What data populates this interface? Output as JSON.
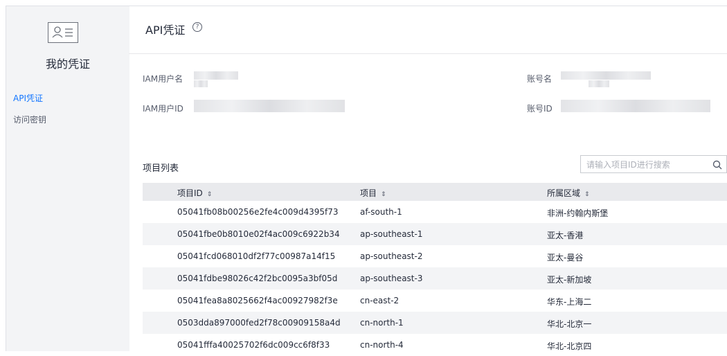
{
  "sidebar": {
    "title": "我的凭证",
    "items": [
      {
        "label": "API凭证",
        "active": true
      },
      {
        "label": "访问密钥",
        "active": false
      }
    ]
  },
  "header": {
    "title": "API凭证",
    "help_icon": "?"
  },
  "info": {
    "iam_user_label": "IAM用户名",
    "iam_user_id_label": "IAM用户ID",
    "account_label": "账号名",
    "account_id_label": "账号ID"
  },
  "projects": {
    "section_title": "项目列表",
    "search_placeholder": "请输入项目ID进行搜索",
    "columns": [
      "项目ID",
      "项目",
      "所属区域"
    ],
    "sort_icon": "⇕",
    "rows": [
      {
        "id": "05041fb08b00256e2fe4c009d4395f73",
        "project": "af-south-1",
        "region": "非洲-约翰内斯堡"
      },
      {
        "id": "05041fbe0b8010e02f4ac009c6922b34",
        "project": "ap-southeast-1",
        "region": "亚太-香港"
      },
      {
        "id": "05041fcd068010df2f77c00987a14f15",
        "project": "ap-southeast-2",
        "region": "亚太-曼谷"
      },
      {
        "id": "05041fdbe98026c42f2bc0095a3bf05d",
        "project": "ap-southeast-3",
        "region": "亚太-新加坡"
      },
      {
        "id": "05041fea8a8025662f4ac00927982f3e",
        "project": "cn-east-2",
        "region": "华东-上海二"
      },
      {
        "id": "0503dda897000fed2f78c00909158a4d",
        "project": "cn-north-1",
        "region": "华北-北京一"
      },
      {
        "id": "05041fffa40025702f6dc009cc6f8f33",
        "project": "cn-north-4",
        "region": "华北-北京四"
      }
    ]
  }
}
